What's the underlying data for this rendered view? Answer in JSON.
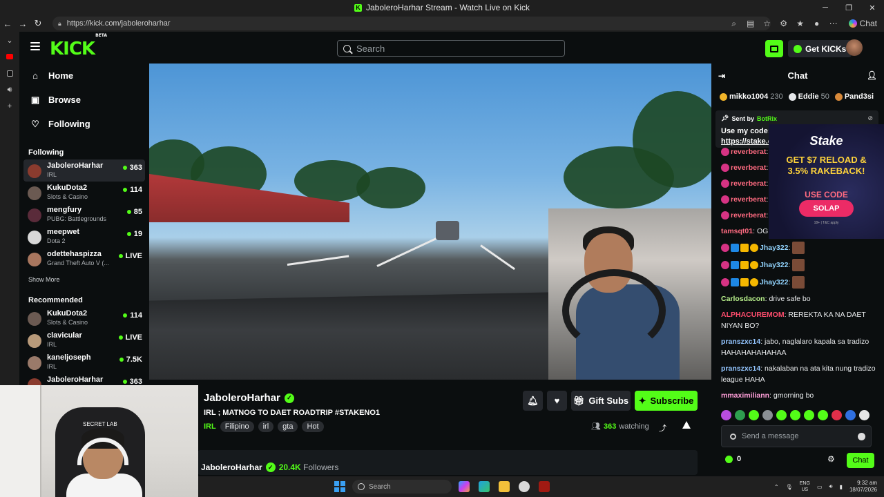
{
  "window": {
    "title": "JaboleroHarhar Stream - Watch Live on Kick"
  },
  "browser": {
    "url": "https://kick.com/jaboleroharhar",
    "copilot_label": "Chat"
  },
  "header": {
    "logo": "KICK",
    "logo_tag": "BETA",
    "search_placeholder": "Search",
    "get_kicks_label": "Get KICKs"
  },
  "sidebar": {
    "nav": [
      {
        "label": "Home",
        "icon": "home-icon"
      },
      {
        "label": "Browse",
        "icon": "browse-icon"
      },
      {
        "label": "Following",
        "icon": "heart-icon"
      }
    ],
    "following_title": "Following",
    "following": [
      {
        "name": "JaboleroHarhar",
        "category": "IRL",
        "viewers": "363",
        "avatar_color": "#8a3b2e"
      },
      {
        "name": "KukuDota2",
        "category": "Slots & Casino",
        "viewers": "114",
        "avatar_color": "#6b5a52"
      },
      {
        "name": "mengfury",
        "category": "PUBG: Battlegrounds",
        "viewers": "85",
        "avatar_color": "#5a2b3a"
      },
      {
        "name": "meepwet",
        "category": "Dota 2",
        "viewers": "19",
        "avatar_color": "#d8d8d8"
      },
      {
        "name": "odettehaspizza",
        "category": "Grand Theft Auto V (...",
        "viewers": "LIVE",
        "avatar_color": "#a8765e"
      }
    ],
    "show_more": "Show More",
    "recommended_title": "Recommended",
    "recommended": [
      {
        "name": "KukuDota2",
        "category": "Slots & Casino",
        "viewers": "114",
        "avatar_color": "#6b5a52"
      },
      {
        "name": "clavicular",
        "category": "IRL",
        "viewers": "LIVE",
        "avatar_color": "#b89a7a"
      },
      {
        "name": "kaneljoseph",
        "category": "IRL",
        "viewers": "7.5K",
        "avatar_color": "#9a7a6a"
      },
      {
        "name": "JaboleroHarhar",
        "category": "",
        "viewers": "363",
        "avatar_color": "#8a3b2e"
      }
    ]
  },
  "stream": {
    "streamer": "JaboleroHarhar",
    "title": "IRL ; MATNOG TO DAET ROADTRIP #STAKENO1",
    "category": "IRL",
    "tags": [
      "Filipino",
      "irl",
      "gta",
      "Hot"
    ],
    "gift_subs_label": "Gift Subs",
    "subscribe_label": "Subscribe",
    "viewers": "363",
    "watching_label": "watching",
    "followers": "20.4K",
    "followers_label": "Followers"
  },
  "chat": {
    "title": "Chat",
    "gifters": [
      {
        "name": "mikko1004",
        "amount": "230",
        "color": "#f0b429"
      },
      {
        "name": "Eddie",
        "amount": "50",
        "color": "#e5e7ea"
      },
      {
        "name": "Pand3si",
        "amount": "",
        "color": "#d8893a"
      }
    ],
    "pinned": {
      "sent_by": "Sent by",
      "bot": "BotRix",
      "line1": "Use my code:",
      "link": "https://stake.c"
    },
    "ad": {
      "brand": "Stake",
      "headline1": "GET $7 RELOAD &",
      "headline2": "3.5% RAKEBACK!",
      "use_code": "USE CODE",
      "code": "SOLAP",
      "fine": "18+ | T&C apply"
    },
    "messages": [
      {
        "user": "reverberat",
        "text": "",
        "color": "#ff6b81"
      },
      {
        "user": "reverberat",
        "text": "",
        "color": "#ff6b81"
      },
      {
        "user": "reverberat",
        "text": "",
        "color": "#ff6b81"
      },
      {
        "user": "reverberat",
        "text": "",
        "color": "#ff6b81"
      },
      {
        "user": "reverberat",
        "text": "",
        "color": "#ff6b81"
      },
      {
        "user": "tamsqt01",
        "text": "OG",
        "color": "#ff6b81"
      },
      {
        "user": "Jhay322",
        "text": "",
        "color": "#93d5ff"
      },
      {
        "user": "Jhay322",
        "text": "",
        "color": "#93d5ff"
      },
      {
        "user": "Jhay322",
        "text": "",
        "color": "#93d5ff"
      },
      {
        "user": "Carlosdacon",
        "text": "drive safe bo",
        "color": "#b9f18c"
      },
      {
        "user": "ALPHACUREMOM",
        "text": "REREKTA KA NA DAET NIYAN BO?",
        "color": "#ff4d6d"
      },
      {
        "user": "pranszxc14",
        "text": "jabo, naglalaro kapala sa tradizo HAHAHAHAHAHAA",
        "color": "#93c5ff"
      },
      {
        "user": "pranszxc14",
        "text": "nakalaban na ata kita nung tradizo league HAHA",
        "color": "#93c5ff"
      },
      {
        "user": "mmaximiliann",
        "text": "gmorning bo",
        "color": "#ff9ed8"
      }
    ],
    "send_placeholder": "Send a message",
    "points": "0",
    "send_label": "Chat"
  },
  "taskbar": {
    "search_placeholder": "Search",
    "lang1": "ENG",
    "lang2": "US",
    "time": "9:32 am",
    "date": "18/07/2026"
  }
}
